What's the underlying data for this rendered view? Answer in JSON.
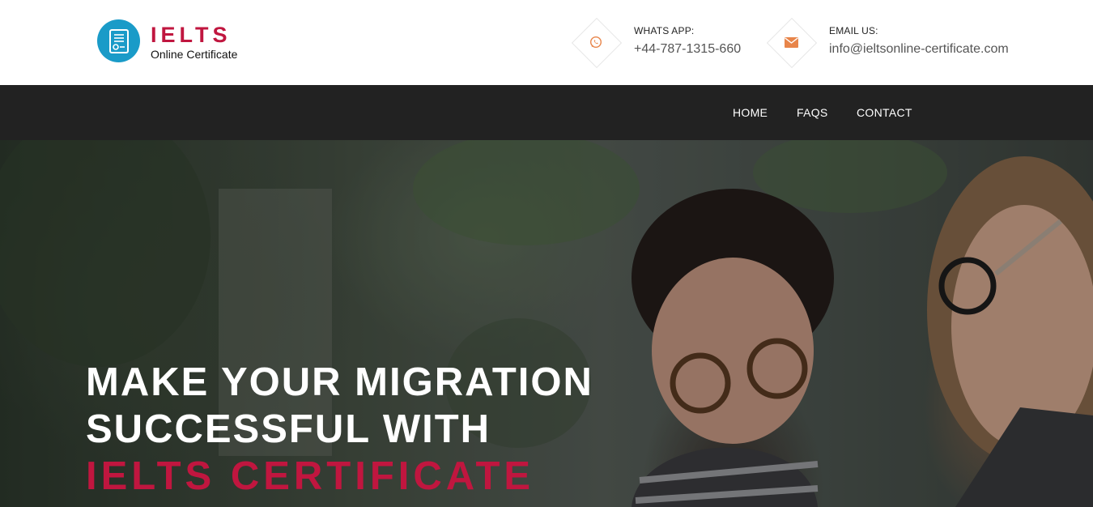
{
  "brand": {
    "title": "IELTS",
    "subtitle": "Online Certificate",
    "logo_icon": "certificate-icon",
    "logo_color": "#1a9bc8",
    "accent_color": "#c0163f"
  },
  "contacts": [
    {
      "label": "WHATS APP:",
      "value": "+44-787-1315-660",
      "icon": "whatsapp-icon",
      "icon_color": "#e8854a"
    },
    {
      "label": "EMAIL US:",
      "value": "info@ieltsonline-certificate.com",
      "icon": "envelope-icon",
      "icon_color": "#e8854a"
    }
  ],
  "nav": {
    "items": [
      {
        "label": "HOME"
      },
      {
        "label": "FAQS"
      },
      {
        "label": "CONTACT"
      }
    ],
    "background": "#222222"
  },
  "hero": {
    "line1": "MAKE YOUR MIGRATION",
    "line2": "SUCCESSFUL WITH",
    "line3": "IELTS CERTIFICATE"
  }
}
